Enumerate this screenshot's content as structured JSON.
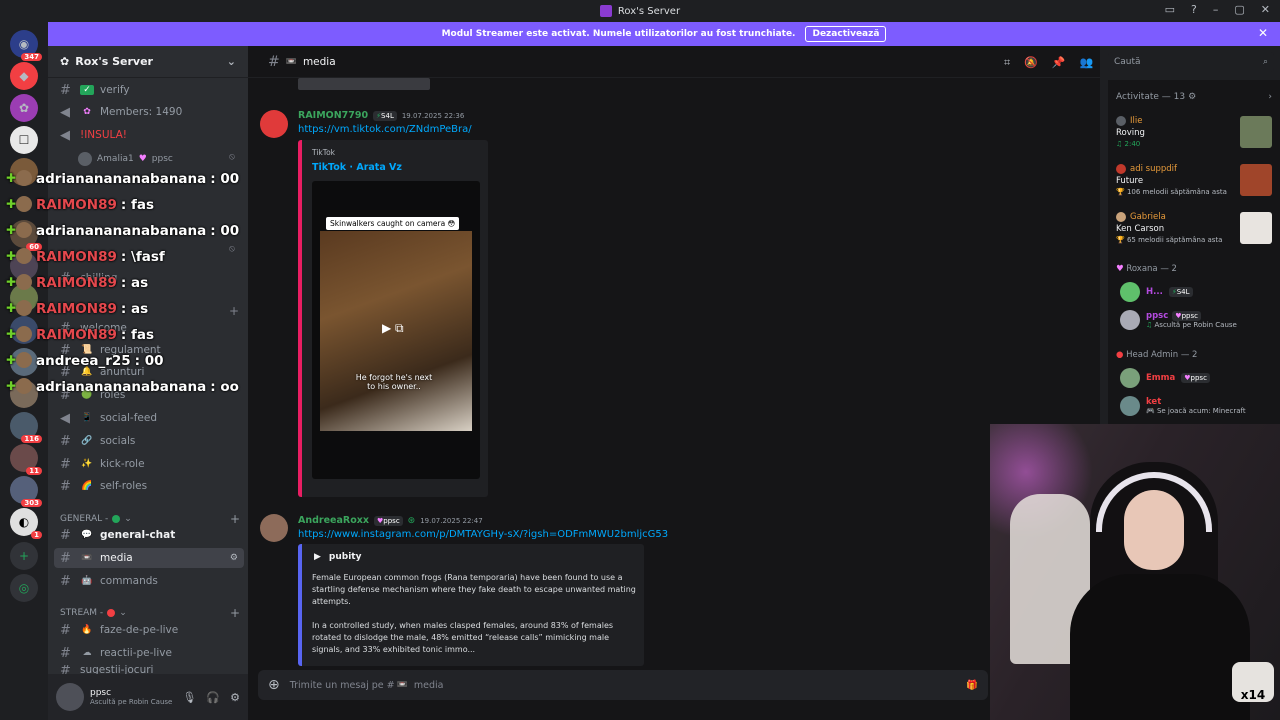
{
  "window": {
    "title": "Rox's Server"
  },
  "banner": {
    "text": "Modul Streamer este activat. Numele utilizatorilor au fost trunchiate.",
    "button": "Dezactivează"
  },
  "guild_badges": [
    "347",
    "60",
    "116",
    "11",
    "303",
    "1"
  ],
  "server": {
    "name": "Rox's Server"
  },
  "channels": {
    "verify": "verify",
    "members": "Members: 1490",
    "insula": "!INSULA!",
    "voice_user": "Amalia1",
    "voice_tag": "ppsc",
    "partial1": "chilling",
    "partial2": "welcome",
    "regulament": "regulament",
    "anunturi": "anunturi",
    "roles": "roles",
    "social_feed": "social-feed",
    "socials": "socials",
    "kick_role": "kick-role",
    "self_roles": "self-roles",
    "cat_general": "GENERAL -",
    "general_chat": "general-chat",
    "media": "media",
    "commands": "commands",
    "cat_stream": "STREAM -",
    "faze": "faze-de-pe-live",
    "reactii": "reactii-pe-live",
    "partial3": "sugestii-jocuri"
  },
  "overlay_chat": [
    {
      "user": "adriananananabanana",
      "text": ": 00",
      "red": false
    },
    {
      "user": "RAIMON89",
      "text": ": fas",
      "red": true
    },
    {
      "user": "adriananananabanana",
      "text": ": 00",
      "red": false
    },
    {
      "user": "RAIMON89",
      "text": ": \\fasf",
      "red": true
    },
    {
      "user": "RAIMON89",
      "text": ": as",
      "red": true
    },
    {
      "user": "RAIMON89",
      "text": ": as",
      "red": true
    },
    {
      "user": "RAIMON89",
      "text": ": fas",
      "red": true
    },
    {
      "user": "andreea_r25",
      "text": ": 00",
      "red": false
    },
    {
      "user": "adriananananabanana",
      "text": ": oo",
      "red": false
    }
  ],
  "userbar": {
    "name": "ppsc",
    "status": "Ascultă pe Robin Cause"
  },
  "header": {
    "channel": "media",
    "search_placeholder": "Caută"
  },
  "messages": [
    {
      "author": "RAIMON7790",
      "tag": "S4L",
      "time": "19.07.2025 22:36",
      "link": "https://vm.tiktok.com/ZNdmPeBra/",
      "embed_provider": "TikTok",
      "embed_title": "TikTok · Arata Vz",
      "video_caption_top": "Skinwalkers caught on camera 😳",
      "video_caption_bottom": "He forgot he's next to his owner.."
    },
    {
      "author": "AndreeaRoxx",
      "tag": "ppsc",
      "time": "19.07.2025 22:47",
      "link": "https://www.instagram.com/p/DMTAYGHy-sX/?igsh=ODFmMWU2bmljcG53",
      "embed_provider": "pubity",
      "embed_desc1": "Female European common frogs (Rana temporaria) have been found to use a startling defense mechanism where they fake death to escape unwanted mating attempts.",
      "embed_desc2": "In a controlled study, when males clasped females, around 83% of females rotated to dislodge the male, 48% emitted “release calls” mimicking male signals, and 33% exhibited tonic immo..."
    }
  ],
  "composer": {
    "placeholder": "Trimite un mesaj pe #",
    "channel": "media"
  },
  "activity": {
    "header": "Activitate — 13",
    "items": [
      {
        "name": "Ilie",
        "song": "Roving",
        "sub": "2:40"
      },
      {
        "name": "adi suppdif",
        "song": "Future",
        "sub": "106 melodii săptămâna asta"
      },
      {
        "name": "Gabriela",
        "song": "Ken Carson",
        "sub": "65 melodii săptămâna asta"
      }
    ]
  },
  "roles": [
    {
      "title": "Roxana — 2",
      "members": [
        {
          "name": "H...",
          "tag": "S4L",
          "sub": ""
        },
        {
          "name": "ppsc",
          "tag": "ppsc",
          "sub": "Ascultă pe Robin Cause"
        }
      ]
    },
    {
      "title": "Head Admin — 2",
      "members": [
        {
          "name": "Emma",
          "tag": "ppsc",
          "sub": ""
        },
        {
          "name": "ket",
          "tag": "",
          "sub": "Se joacă acum: Minecraft"
        }
      ]
    }
  ],
  "webcam": {
    "overlay_text": "x14"
  },
  "colors": {
    "accent": "#7d5cff",
    "link": "#00a8fc",
    "danger": "#f23f43"
  }
}
